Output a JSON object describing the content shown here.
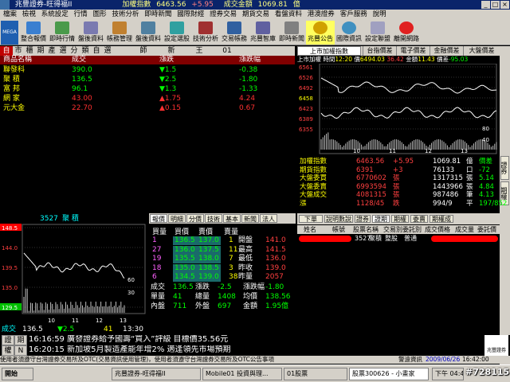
{
  "window": {
    "title": "兆豐證券-旺得福II",
    "index_name": "加權指數",
    "index_value": "6463.56",
    "index_change": "+5.95",
    "volume_label": "成交金額",
    "volume_value": "1069.81",
    "unit": "億"
  },
  "menu": [
    "檔案",
    "檢視",
    "系統設定",
    "行情",
    "圖形",
    "技術分析",
    "即時新聞",
    "國際財經",
    "證券交易",
    "期貨交易",
    "看盤資料",
    "港澳證券",
    "客戶服務",
    "說明"
  ],
  "toolbar": [
    "整合報價",
    "即時行情",
    "盤後資料",
    "帳務管理",
    "盤後資料",
    "設定選股",
    "技術分析",
    "交易帳務",
    "兆豐智庫",
    "即時新聞",
    "兆豐公告",
    "國際資訊",
    "設定聯盟",
    "離開網路"
  ],
  "tabs": [
    "自",
    "市",
    "櫃",
    "期",
    "產",
    "選",
    "分",
    "類",
    "自",
    "選",
    "師",
    "新",
    "王",
    "01"
  ],
  "stock_table": {
    "headers": [
      "商品名稱",
      "成交",
      "漲跌",
      "漲跌幅"
    ],
    "rows": [
      {
        "name": "聯發科",
        "price": "390.0",
        "chg": "▼1.5",
        "pct": "-0.38",
        "dir": "down"
      },
      {
        "name": "聚 積",
        "price": "136.5",
        "chg": "▼2.5",
        "pct": "-1.80",
        "dir": "down"
      },
      {
        "name": "富 邦",
        "price": "96.1",
        "chg": "▼1.3",
        "pct": "-1.33",
        "dir": "down"
      },
      {
        "name": "網 家",
        "price": "43.00",
        "chg": "▲1.75",
        "pct": "4.24",
        "dir": "up"
      },
      {
        "name": "元大金",
        "price": "22.70",
        "chg": "▲0.15",
        "pct": "0.67",
        "dir": "up"
      }
    ]
  },
  "right_chart": {
    "dropdown": "上市加權指數",
    "tabs": [
      "台指價差",
      "電子價差",
      "金融價差",
      "大盤價差"
    ],
    "info": {
      "label": "上市加權",
      "time_label": "時間",
      "time": "12:20",
      "price_label": "價",
      "price": "6494.03",
      "change": "36.42",
      "volume_label": "金額",
      "volume": "11.43",
      "spread_label": "價差",
      "spread": "-95.03"
    },
    "y_labels": [
      "6561",
      "6526",
      "6492",
      "6458",
      "6423",
      "6389",
      "6355"
    ],
    "vol_labels": [
      "80",
      "40"
    ],
    "x_labels": [
      "10",
      "11",
      "12",
      "13"
    ]
  },
  "index_panel": {
    "rows": [
      {
        "label": "加權指數",
        "v1": "6463.56",
        "v2": "+5.95",
        "v3": "1069.81",
        "v4": "億",
        "v5": "價差"
      },
      {
        "label": "期貨指數",
        "v1": "6391",
        "v2": "+3",
        "v3": "76133",
        "v4": "口",
        "v5": "-72"
      },
      {
        "label": "大盤委買",
        "v1": "6770602",
        "v2": "張",
        "v3": "1317315",
        "v4": "張",
        "v5": "5.14"
      },
      {
        "label": "大盤委賣",
        "v1": "6993594",
        "v2": "張",
        "v3": "1443966",
        "v4": "張",
        "v5": "4.84"
      },
      {
        "label": "大盤成交",
        "v1": "4081315",
        "v2": "張",
        "v3": "987486",
        "v4": "筆",
        "v5": "4.13"
      },
      {
        "label": "漲",
        "v1": "1128/45",
        "v2": "跌",
        "v3": "994/9",
        "v4": "平",
        "v5": "197/852"
      }
    ]
  },
  "left_chart": {
    "symbol": "3527",
    "name": "聚 積",
    "y_labels": [
      "148.5",
      "144.0",
      "139.5",
      "135.0",
      "129.5"
    ],
    "vol_labels": [
      "60",
      "30"
    ],
    "x_labels": [
      "10",
      "11",
      "12",
      "13"
    ],
    "footer": {
      "label": "成交",
      "price": "136.5",
      "chg": "▼2.5",
      "vol": "41",
      "time": "13:30"
    }
  },
  "quotes": {
    "tabs": [
      "報價",
      "明細",
      "分價",
      "技術",
      "基本",
      "新聞",
      "法人"
    ],
    "headers": [
      "買量",
      "買價",
      "賣價",
      "賣量"
    ],
    "rows": [
      {
        "bq": "1",
        "bp": "136.5",
        "sp": "137.0",
        "sq": "1",
        "ol": "開盤",
        "ov": "141.0"
      },
      {
        "bq": "27",
        "bp": "136.0",
        "sp": "137.5",
        "sq": "11",
        "ol": "最高",
        "ov": "141.5"
      },
      {
        "bq": "19",
        "bp": "135.5",
        "sp": "138.0",
        "sq": "7",
        "ol": "最低",
        "ov": "136.0"
      },
      {
        "bq": "18",
        "bp": "135.0",
        "sp": "138.5",
        "sq": "3",
        "ol": "昨收",
        "ov": "139.0"
      },
      {
        "bq": "6",
        "bp": "134.5",
        "sp": "139.0",
        "sq": "38",
        "ol": "昨量",
        "ov": "2057"
      }
    ],
    "summary": [
      {
        "a": "成交",
        "b": "136.5",
        "c": "漲跌",
        "d": "-2.5",
        "e": "漲跌幅",
        "f": "-1.80"
      },
      {
        "a": "單量",
        "b": "41",
        "c": "總量",
        "d": "1408",
        "e": "均價",
        "f": "138.56"
      },
      {
        "a": "內盤",
        "b": "711",
        "c": "外盤",
        "d": "697",
        "e": "金額",
        "f": "1.95億"
      }
    ]
  },
  "orders": {
    "buttons": [
      "下單",
      "說明數說",
      "證券",
      "證期",
      "期權",
      "委賣",
      "期權成"
    ],
    "headers": [
      "姓名",
      "帳號",
      "股票名稱",
      "交易別",
      "委託別",
      "成交價格",
      "成交量",
      "委託價"
    ],
    "row": {
      "code": "3527",
      "name": "聚積",
      "type": "整股",
      "kind": "普通"
    }
  },
  "news": {
    "buttons": [
      "證",
      "期",
      "權",
      "N"
    ],
    "items": [
      {
        "time": "16:16:59",
        "text": "廣發證券給予國壽“買入”評級 目標價35.56元"
      },
      {
        "time": "16:20:15",
        "text": "新加坡5月製造產能年增2% 適逢領先市場預期"
      }
    ],
    "logo": "兆豐證券"
  },
  "statusbar": {
    "text": "使用者須遵守台灣證券交易所及OTC(交易資訊使用管理)，使用者須遵守台灣證券交易所及OTC公告事項",
    "right": "警遠資訊",
    "date": "2009/06/26",
    "time": "16:42:00"
  },
  "taskbar": {
    "start": "開始",
    "tasks": [
      "兆豐證券-旺得福II",
      "Mobile01 投資與理...",
      "01股票",
      "股票300626 - 小畫家"
    ],
    "clock": "下午 04:40",
    "watermark": "#728115"
  }
}
